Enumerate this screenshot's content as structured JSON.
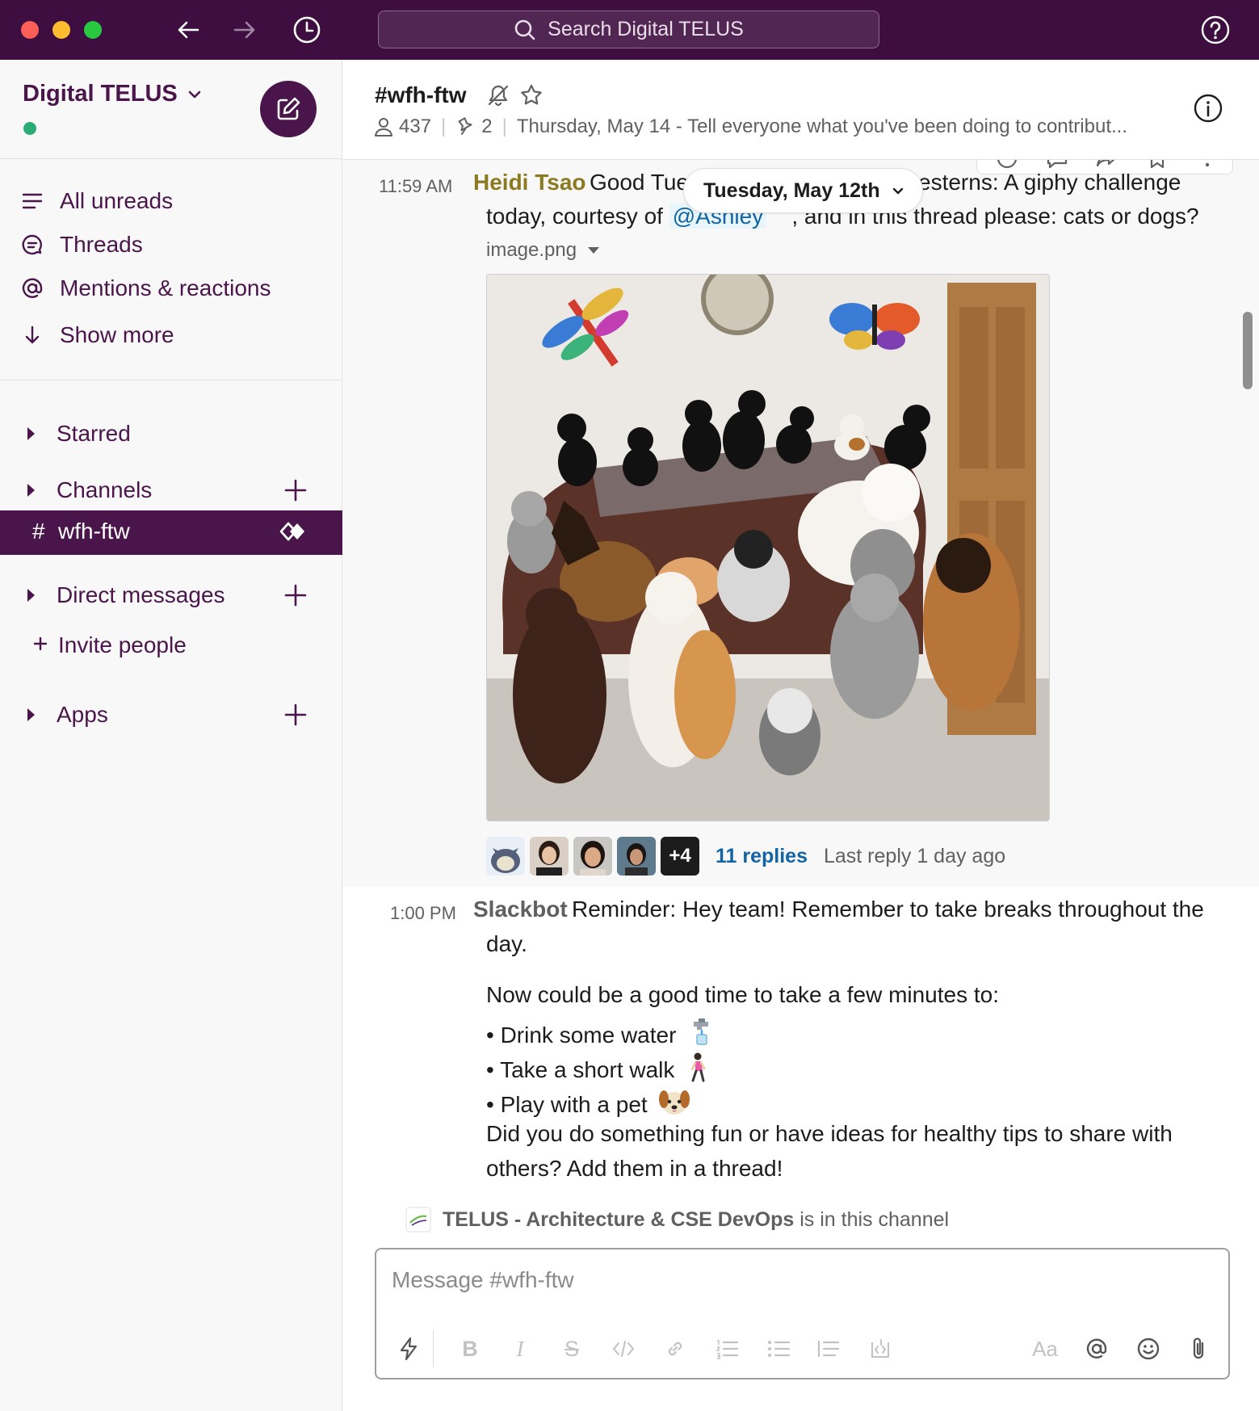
{
  "search": {
    "placeholder": "Search Digital TELUS"
  },
  "workspace": {
    "name": "Digital TELUS",
    "status_color": "#2bac76"
  },
  "sidebar": {
    "nav": [
      {
        "label": "All unreads",
        "icon": "list-icon"
      },
      {
        "label": "Threads",
        "icon": "threads-icon"
      },
      {
        "label": "Mentions & reactions",
        "icon": "at-icon"
      },
      {
        "label": "Show more",
        "icon": "arrow-down-icon"
      }
    ],
    "sections": {
      "starred": "Starred",
      "channels": "Channels",
      "direct_messages": "Direct messages",
      "apps": "Apps"
    },
    "active_channel": {
      "hash": "#",
      "name": "wfh-ftw"
    },
    "invite": "Invite people"
  },
  "channel": {
    "title": "#wfh-ftw",
    "members": "437",
    "pins": "2",
    "topic": "Thursday, May 14 - Tell everyone what you've been doing to contribut..."
  },
  "date_divider": "Tuesday, May 12th",
  "messages": [
    {
      "time": "11:59 AM",
      "author": "Heidi Tsao",
      "author_color": "#8b7a1f",
      "line1_start": "Good Tue",
      "line1_end": "esterns: A giphy challenge",
      "line2_start": "today, courtesy of",
      "mention": "@Ashley",
      "line2_end": ", and in this thread please: cats or dogs?",
      "file_name": "image.png",
      "reply_more": "+4",
      "replies": "11 replies",
      "last_reply": "Last reply 1 day ago"
    },
    {
      "time": "1:00 PM",
      "author": "Slackbot",
      "author_color": "#616061",
      "line1": "Reminder: Hey team! Remember to take breaks throughout the",
      "line2": "day.",
      "line3": "Now could be a good time to take a few minutes to:",
      "bullet1": "• Drink some water",
      "bullet2": "• Take a short walk",
      "bullet3": "• Play with a pet",
      "line4": "Did you do something fun or have ideas for healthy tips to share with",
      "line5": "others? Add them in a thread!"
    }
  ],
  "channel_join": {
    "name": "TELUS - Architecture & CSE DevOps",
    "suffix": "is in this channel"
  },
  "composer": {
    "placeholder": "Message #wfh-ftw",
    "font_label": "Aa"
  },
  "colors": {
    "titlebar": "#3f0e40",
    "accent": "#4a154b",
    "link": "#1264a3"
  }
}
